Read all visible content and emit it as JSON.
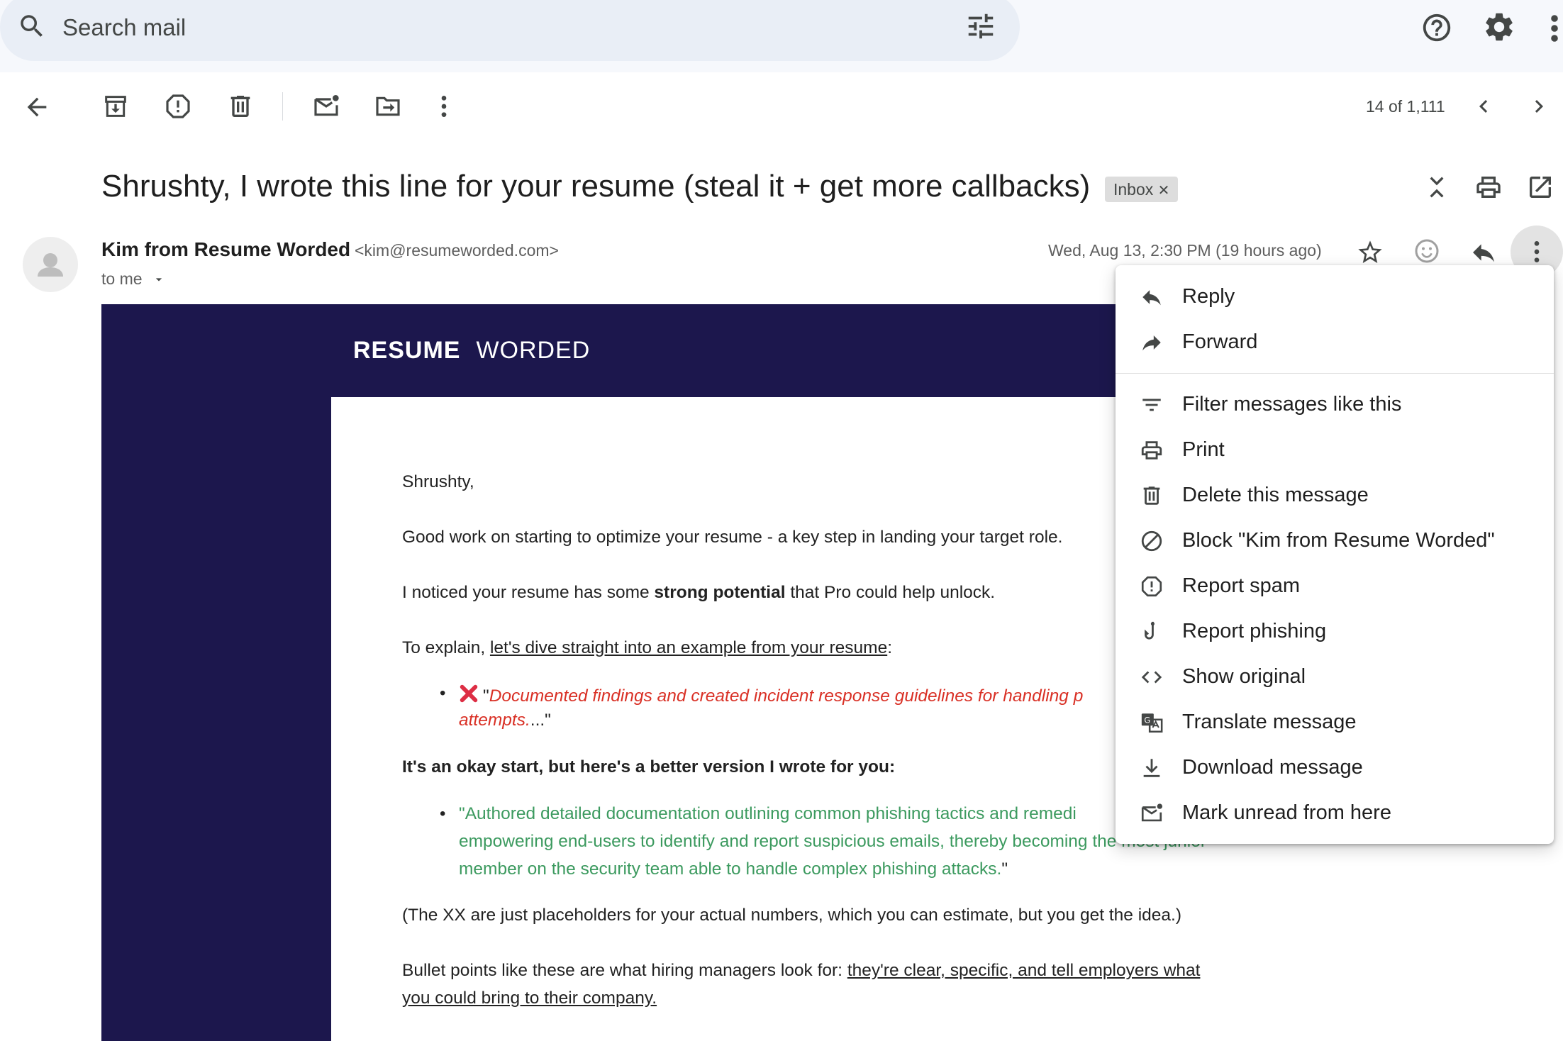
{
  "search": {
    "placeholder": "Search mail"
  },
  "toolbar": {
    "count": "14 of 1,111"
  },
  "email": {
    "subject": "Shrushty, I wrote this line for your resume (steal it + get more callbacks)",
    "label_chip": "Inbox",
    "sender_name": "Kim from Resume Worded",
    "sender_email": "<kim@resumeworded.com>",
    "to": "to me",
    "date": "Wed, Aug 13, 2:30 PM (19 hours ago)"
  },
  "body": {
    "brand_bold": "RESUME",
    "brand_light": "WORDED",
    "greeting": "Shrushty,",
    "p1": "Good work on starting to optimize your resume - a key step in landing your target role.",
    "p2_pre": "I noticed your resume has some ",
    "p2_bold": "strong potential",
    "p2_post": " that Pro could help unlock.",
    "p3_pre": "To explain, ",
    "p3_link": "let's dive straight into an example from your resume",
    "p3_post": ":",
    "bad_open_quote": "\"",
    "bad_line1": "Documented findings and created incident response guidelines for handling p",
    "bad_line2": "attempts.",
    "bad_tail": "...\"",
    "p4": "It's an okay start, but here's a better version I wrote for you:",
    "good_line1": "\"Authored detailed documentation outlining common phishing tactics and remedi",
    "good_line2": "empowering end-users to identify and report suspicious emails, thereby becoming the most junior",
    "good_line3": "member on the security team able to handle complex phishing attacks.",
    "good_tail": "\"",
    "p5": "(The XX are just placeholders for your actual numbers, which you can estimate, but you get the idea.)",
    "p6_pre": "Bullet points like these are what hiring managers look for: ",
    "p6_link1": "they're clear, specific, and tell employers what",
    "p6_link2": "you could bring to their company."
  },
  "menu": {
    "items": [
      {
        "label": "Reply",
        "icon": "reply-icon"
      },
      {
        "label": "Forward",
        "icon": "forward-icon"
      },
      {
        "label": "Filter messages like this",
        "icon": "filter-icon"
      },
      {
        "label": "Print",
        "icon": "print-icon"
      },
      {
        "label": "Delete this message",
        "icon": "trash-icon"
      },
      {
        "label": "Block \"Kim from Resume Worded\"",
        "icon": "block-icon"
      },
      {
        "label": "Report spam",
        "icon": "spam-icon"
      },
      {
        "label": "Report phishing",
        "icon": "phishing-hook-icon"
      },
      {
        "label": "Show original",
        "icon": "code-icon"
      },
      {
        "label": "Translate message",
        "icon": "translate-icon"
      },
      {
        "label": "Download message",
        "icon": "download-icon"
      },
      {
        "label": "Mark unread from here",
        "icon": "mark-unread-icon"
      }
    ]
  },
  "colors": {
    "brand_bg": "#1c174d",
    "bad_text": "#d93025",
    "good_text": "#3c9a5f",
    "search_bg": "#e9eef6"
  }
}
